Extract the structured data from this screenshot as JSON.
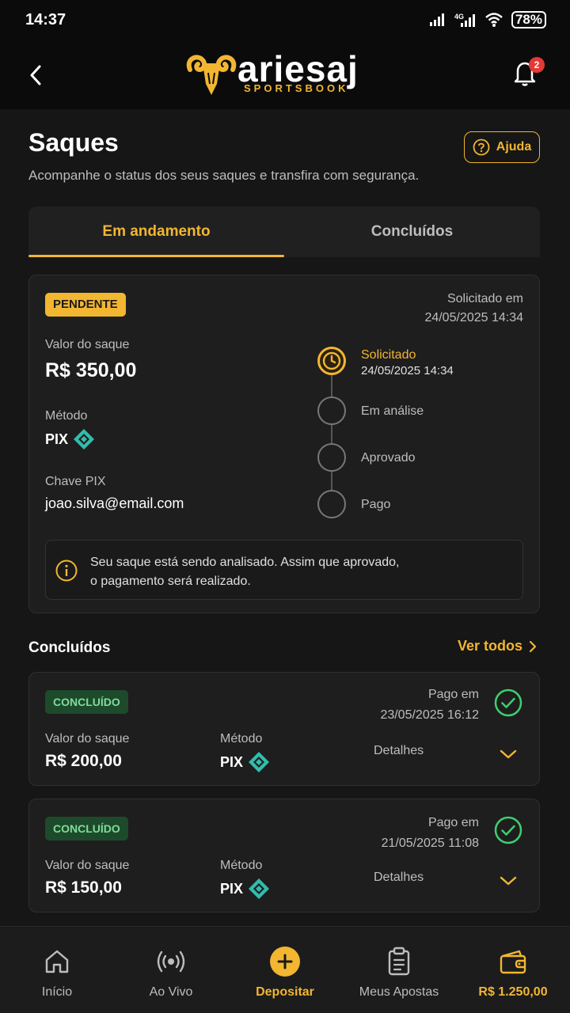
{
  "status_bar": {
    "time": "14:37",
    "network": "4G",
    "battery": "78%"
  },
  "brand": {
    "name": "ariesaj",
    "tagline": "SPORTSBOOK"
  },
  "notifications": {
    "count": "2"
  },
  "page": {
    "title": "Saques",
    "subtitle": "Acompanhe o status dos seus saques e transfira com segurança.",
    "help_label": "Ajuda"
  },
  "tabs": [
    {
      "label": "Em andamento",
      "active": true
    },
    {
      "label": "Concluídos",
      "active": false
    }
  ],
  "pending": {
    "status": "PENDENTE",
    "requested_label": "Solicitado em",
    "requested_at": "24/05/2025 14:34",
    "amount_label": "Valor do saque",
    "amount": "R$ 350,00",
    "method_label": "Método",
    "method": "PIX",
    "key_label": "Chave PIX",
    "key": "joao.silva@email.com",
    "timeline": [
      {
        "label": "Solicitado",
        "date": "24/05/2025 14:34",
        "active": true
      },
      {
        "label": "Em análise",
        "active": false
      },
      {
        "label": "Aprovado",
        "active": false
      },
      {
        "label": "Pago",
        "active": false
      }
    ],
    "info_line1": "Seu saque está sendo analisado. Assim que aprovado,",
    "info_line2": "o pagamento será realizado."
  },
  "completed_section": {
    "title": "Concluídos",
    "see_all": "Ver todos"
  },
  "completed": [
    {
      "status": "CONCLUÍDO",
      "paid_label": "Pago em",
      "paid_at": "23/05/2025 16:12",
      "amount_label": "Valor do saque",
      "amount": "R$ 200,00",
      "method_label": "Método",
      "method": "PIX",
      "details": "Detalhes"
    },
    {
      "status": "CONCLUÍDO",
      "paid_label": "Pago em",
      "paid_at": "21/05/2025 11:08",
      "amount_label": "Valor do saque",
      "amount": "R$ 150,00",
      "method_label": "Método",
      "method": "PIX",
      "details": "Detalhes"
    }
  ],
  "bottom_nav": [
    {
      "label": "Início",
      "icon": "home-icon"
    },
    {
      "label": "Ao Vivo",
      "icon": "live-icon"
    },
    {
      "label": "Depositar",
      "icon": "plus-icon"
    },
    {
      "label": "Meus Apostas",
      "icon": "clipboard-icon"
    },
    {
      "label": "R$ 1.250,00",
      "icon": "wallet-icon"
    }
  ],
  "colors": {
    "accent": "#f2b631",
    "background": "#161616",
    "card": "#1e1e1e",
    "success": "#3ecf6e"
  }
}
